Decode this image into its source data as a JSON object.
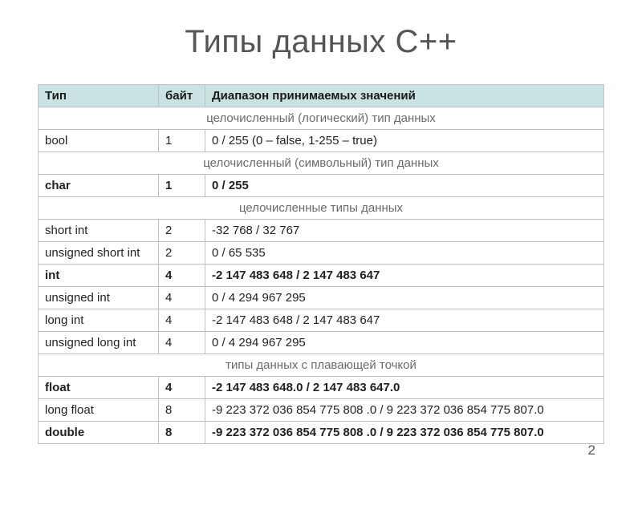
{
  "title": "Типы данных С++",
  "page_number": "2",
  "headers": {
    "type": "Тип",
    "bytes": "байт",
    "range": "Диапазон принимаемых значений"
  },
  "sections": [
    {
      "label": "целочисленный (логический) тип данных"
    },
    {
      "label": "целочисленный (символьный) тип данных"
    },
    {
      "label": "целочисленные типы данных"
    },
    {
      "label": "типы данных с плавающей точкой"
    }
  ],
  "rows": {
    "bool": {
      "type": "bool",
      "bytes": "1",
      "range": "0   /   255 (0 – false, 1-255 – true)"
    },
    "char": {
      "type": "char",
      "bytes": "1",
      "range": "0   /   255"
    },
    "short": {
      "type": "short int",
      "bytes": "2",
      "range": "-32 768    /    32 767"
    },
    "ushort": {
      "type": "unsigned short int",
      "bytes": "2",
      "range": "0  /  65 535"
    },
    "int": {
      "type": "int",
      "bytes": "4",
      "range": "-2 147 483 648   /   2 147 483 647"
    },
    "uint": {
      "type": "unsigned int",
      "bytes": "4",
      "range": "0     /     4 294 967 295"
    },
    "long": {
      "type": "long int",
      "bytes": "4",
      "range": "-2 147 483 648    /    2 147 483 647"
    },
    "ulong": {
      "type": "unsigned long int",
      "bytes": "4",
      "range": "0     /     4 294 967 295"
    },
    "float": {
      "type": "float",
      "bytes": "4",
      "range": "-2 147 483 648.0  / 2 147 483 647.0"
    },
    "lfloat": {
      "type": "long float",
      "bytes": "8",
      "range": "-9 223 372 036 854 775 808 .0   /   9 223 372 036 854 775 807.0"
    },
    "double": {
      "type": "double",
      "bytes": "8",
      "range": "-9 223 372 036 854 775 808 .0   /   9 223 372 036 854 775 807.0"
    }
  }
}
